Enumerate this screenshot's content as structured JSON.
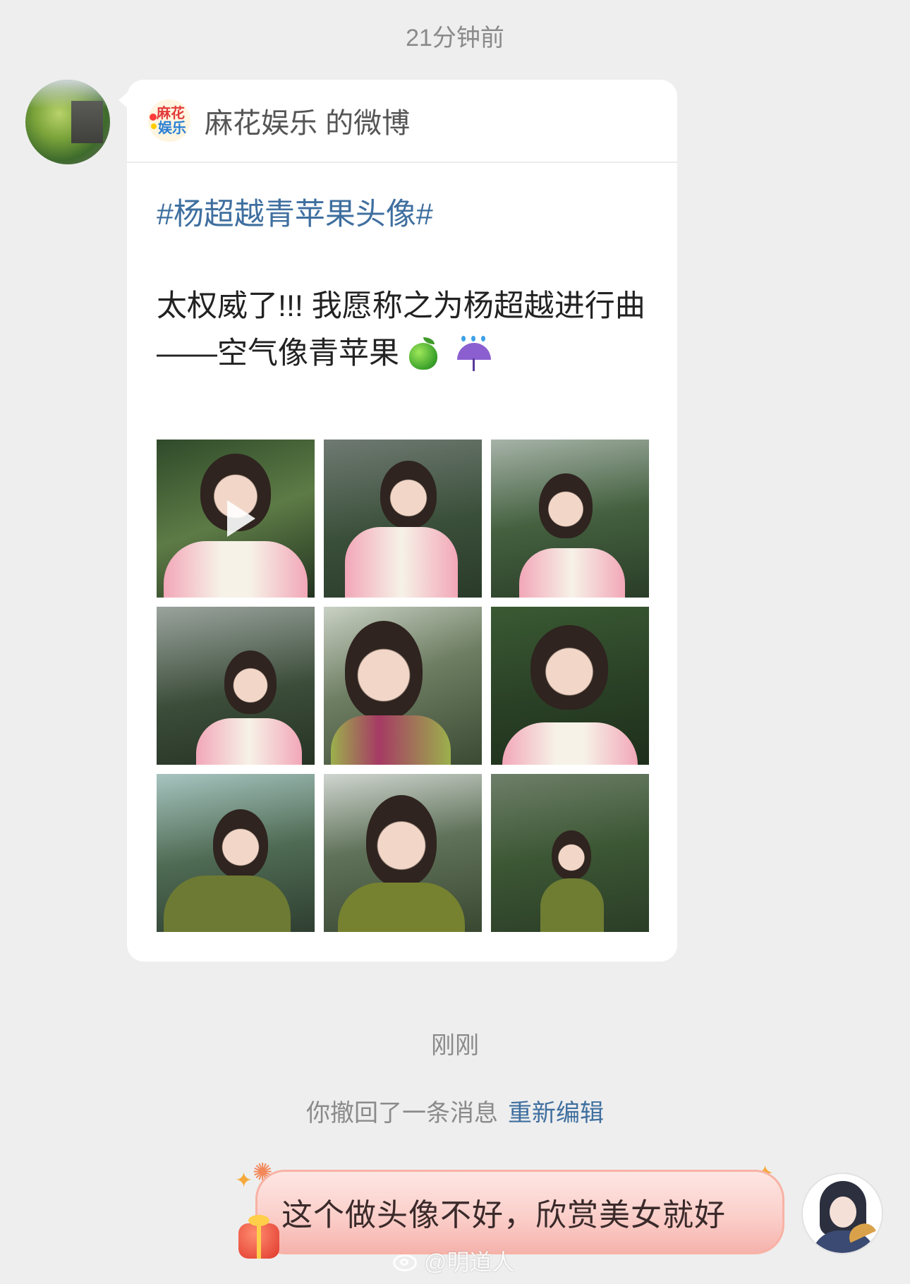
{
  "chat": {
    "timestamp_1": "21分钟前",
    "timestamp_2": "刚刚"
  },
  "shared_card": {
    "title": "麻花娱乐 的微博",
    "brand_logo_text_1": "麻花",
    "brand_logo_text_2": "娱乐",
    "hashtag": "#杨超越青苹果头像#",
    "body_line_1": "太权威了!!! 我愿称之为杨超越进行曲",
    "body_line_2": "——空气像青苹果",
    "emoji_icons": [
      "green-apple-icon",
      "umbrella-rain-icon"
    ],
    "photo_count": 9
  },
  "recall_notice": {
    "text": "你撤回了一条消息",
    "action": "重新编辑"
  },
  "my_message": {
    "text": "这个做头像不好，欣赏美女就好"
  },
  "watermark": {
    "text": "@明道人"
  },
  "colors": {
    "background": "#eeeeee",
    "link": "#3f6f9f",
    "bubble_pink": "#fbcfca",
    "timestamp": "#8a8a8a"
  }
}
